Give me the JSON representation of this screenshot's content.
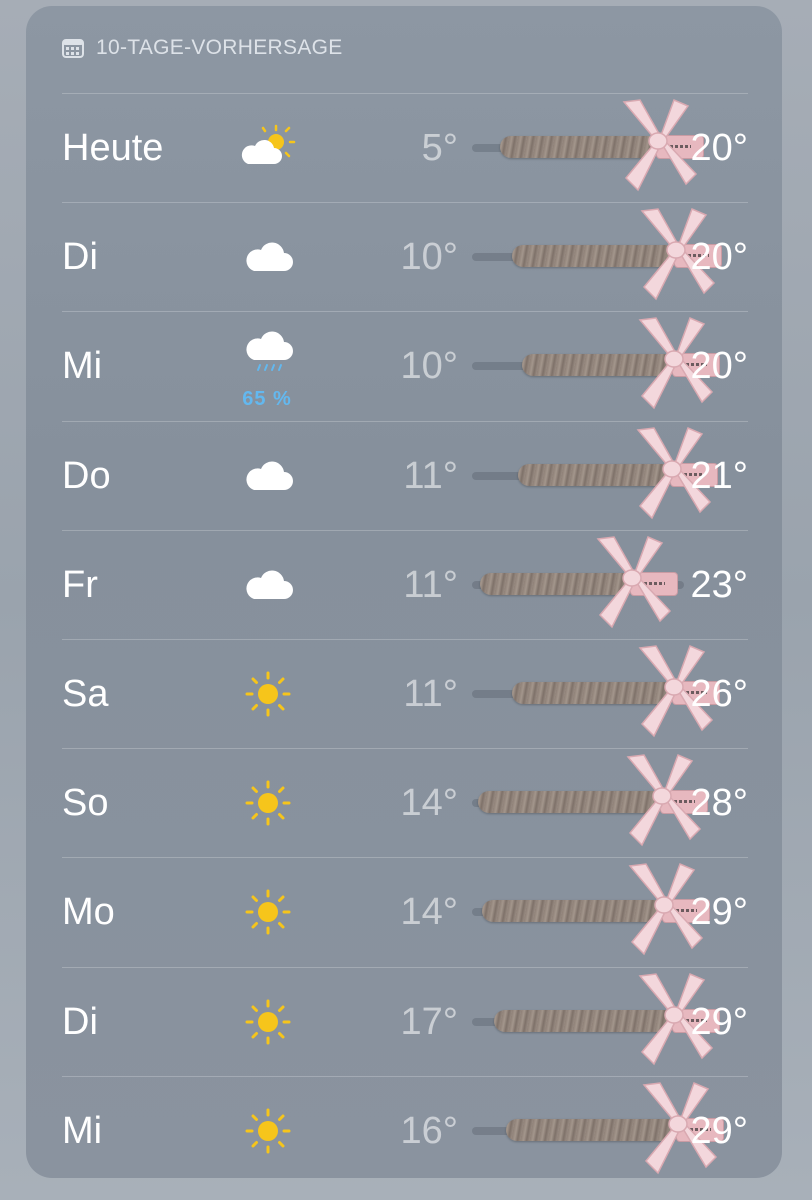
{
  "header": {
    "title": "10-TAGE-VORHERSAGE",
    "icon": "calendar-icon"
  },
  "rows": [
    {
      "day": "Heute",
      "icon": "partly-sunny-icon",
      "precip": "",
      "low": "5°",
      "high": "20°"
    },
    {
      "day": "Di",
      "icon": "cloud-icon",
      "precip": "",
      "low": "10°",
      "high": "20°"
    },
    {
      "day": "Mi",
      "icon": "rain-cloud-icon",
      "precip": "65 %",
      "low": "10°",
      "high": "20°"
    },
    {
      "day": "Do",
      "icon": "cloud-icon",
      "precip": "",
      "low": "11°",
      "high": "21°"
    },
    {
      "day": "Fr",
      "icon": "cloud-icon",
      "precip": "",
      "low": "11°",
      "high": "23°"
    },
    {
      "day": "Sa",
      "icon": "sun-icon",
      "precip": "",
      "low": "11°",
      "high": "26°"
    },
    {
      "day": "So",
      "icon": "sun-icon",
      "precip": "",
      "low": "14°",
      "high": "28°"
    },
    {
      "day": "Mo",
      "icon": "sun-icon",
      "precip": "",
      "low": "14°",
      "high": "29°"
    },
    {
      "day": "Di",
      "icon": "sun-icon",
      "precip": "",
      "low": "17°",
      "high": "29°"
    },
    {
      "day": "Mi",
      "icon": "sun-icon",
      "precip": "",
      "low": "16°",
      "high": "29°"
    }
  ],
  "colors": {
    "precip": "#63b8ef",
    "sun": "#f6c51b",
    "bow": "#f3d7dc"
  }
}
